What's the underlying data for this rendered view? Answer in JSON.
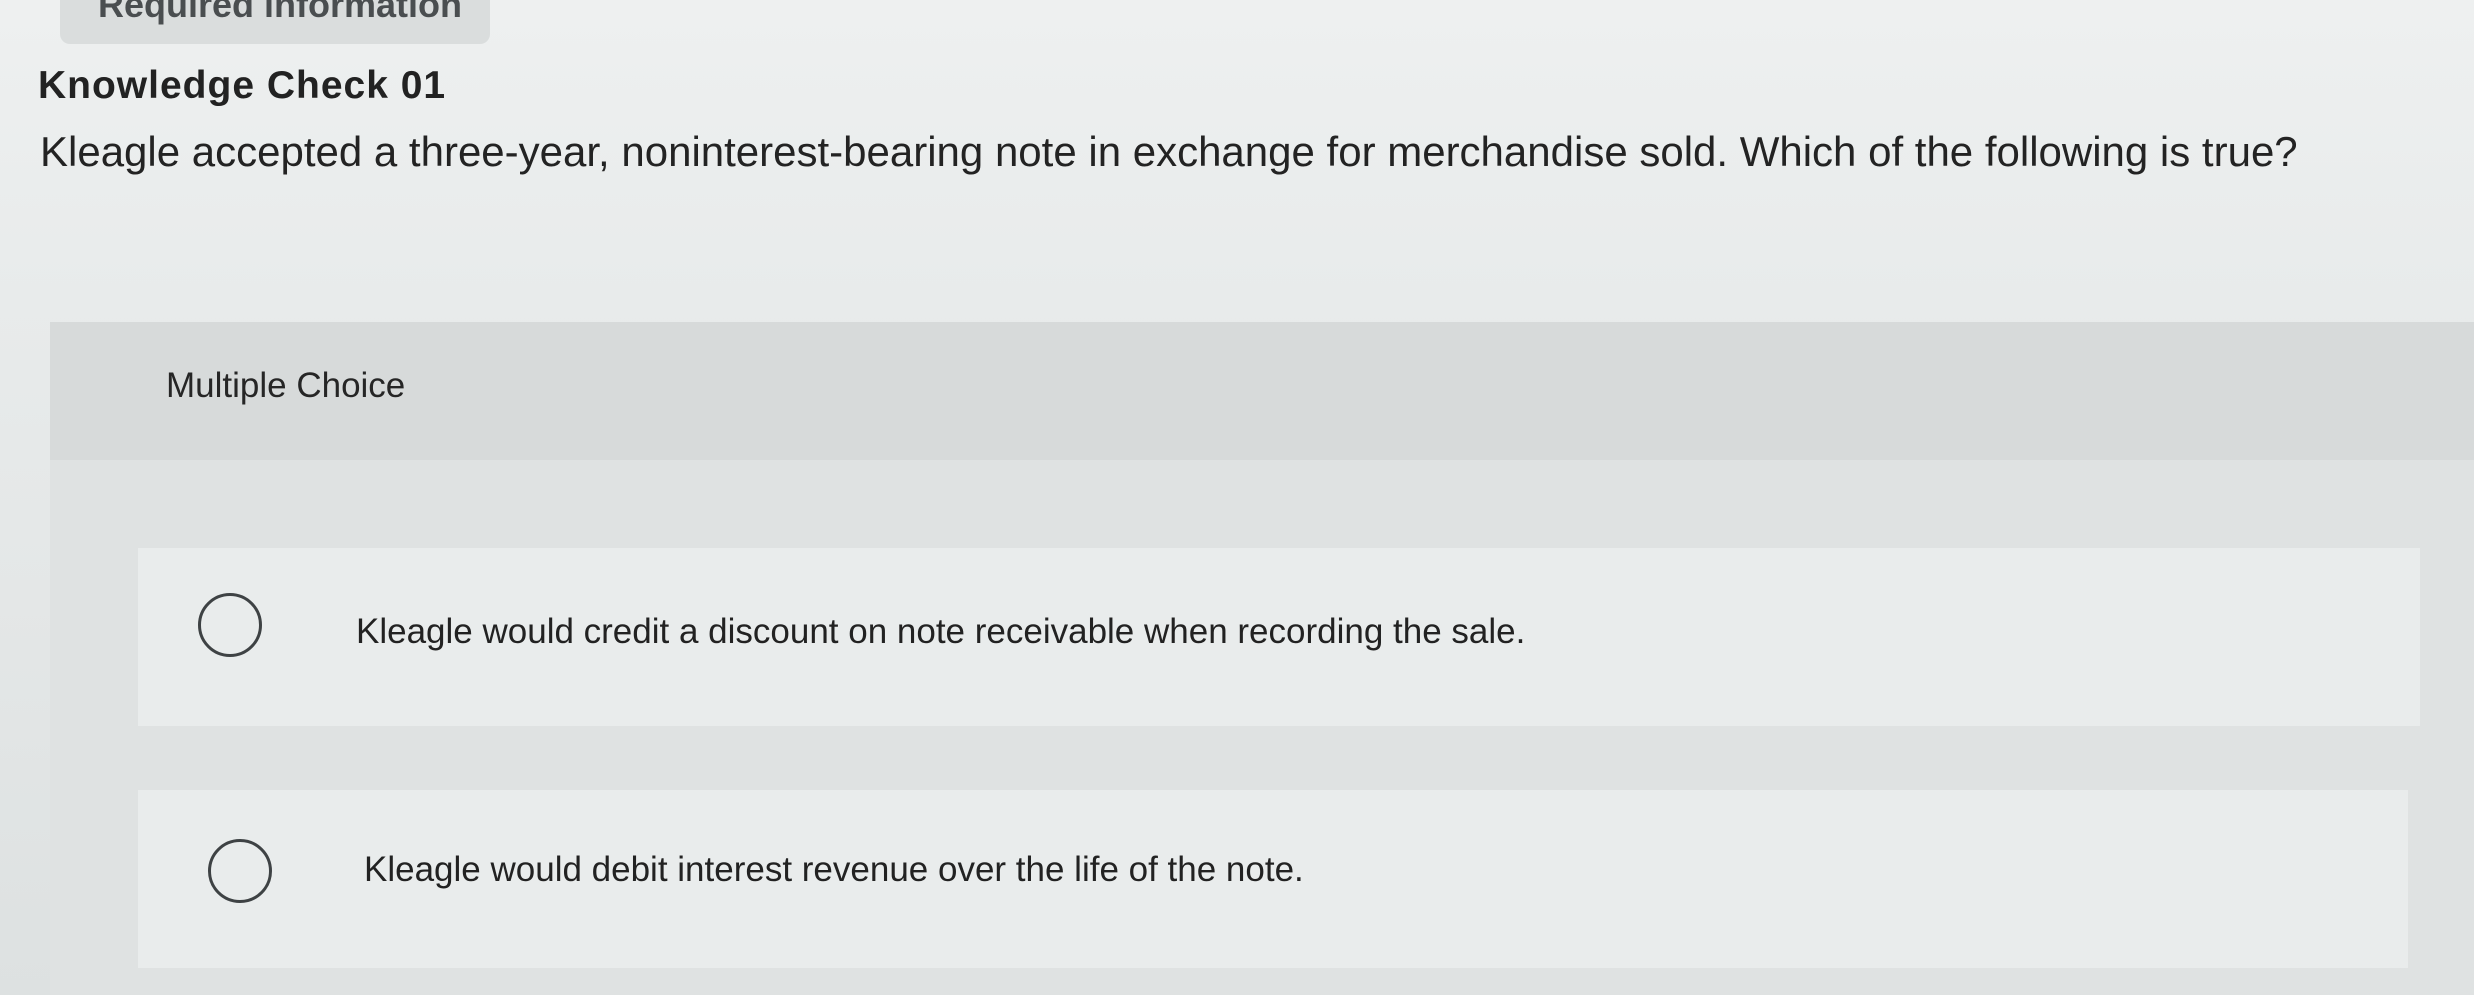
{
  "header": {
    "tab_label": "Required information"
  },
  "question_block": {
    "title": "Knowledge Check 01",
    "prompt": "Kleagle accepted a three-year, noninterest-bearing note in exchange for merchandise sold. Which of the following is true?"
  },
  "multiple_choice": {
    "label": "Multiple Choice",
    "options": [
      {
        "text": "Kleagle would credit a discount on note receivable when recording the sale.",
        "selected": false
      },
      {
        "text": "Kleagle would debit interest revenue over the life of the note.",
        "selected": false
      }
    ]
  }
}
